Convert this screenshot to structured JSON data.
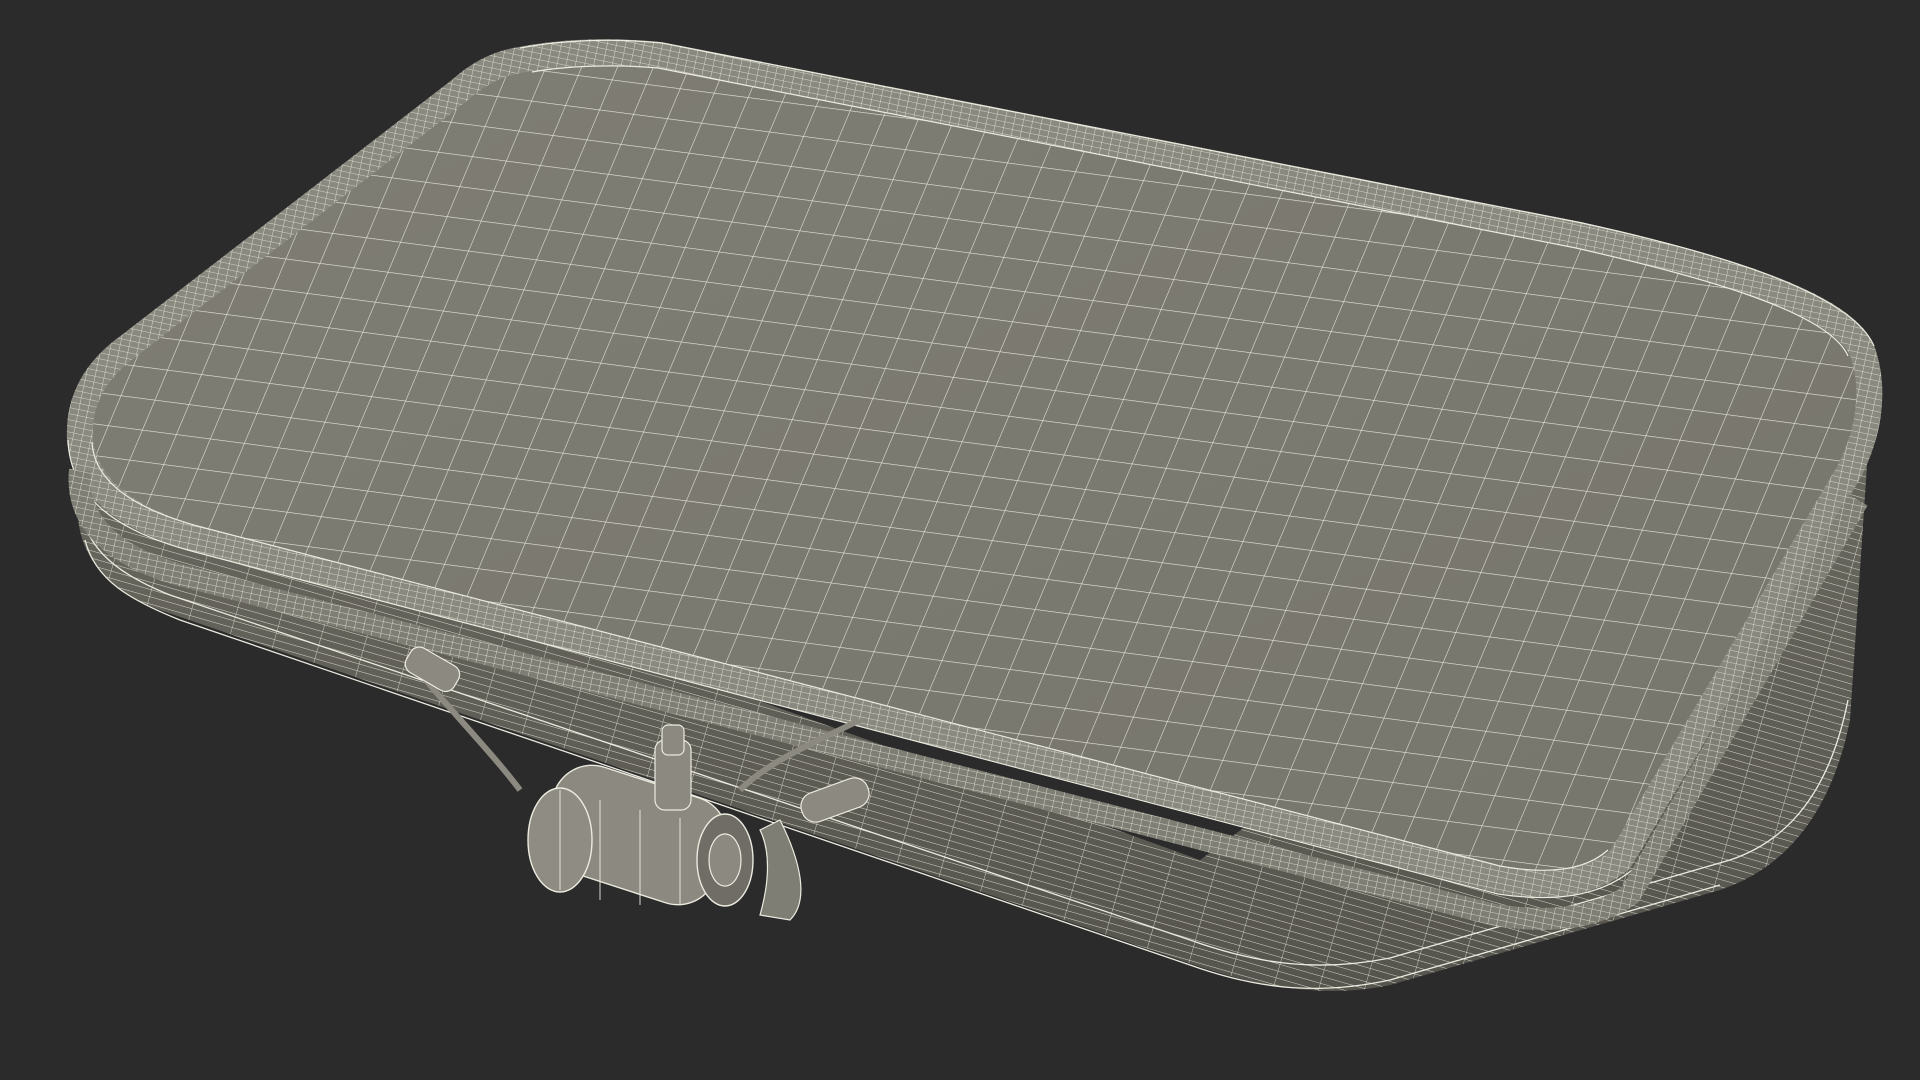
{
  "scene": {
    "subject_icon": "inflatable-bag-wireframe-icon",
    "colors": {
      "background": "#2b2b2b",
      "surface": "#7c7b71",
      "surface_dark": "#5f5e56",
      "surface_light": "#8a897f",
      "wire": "#ecebe0",
      "valve": "#8c8a80"
    }
  }
}
